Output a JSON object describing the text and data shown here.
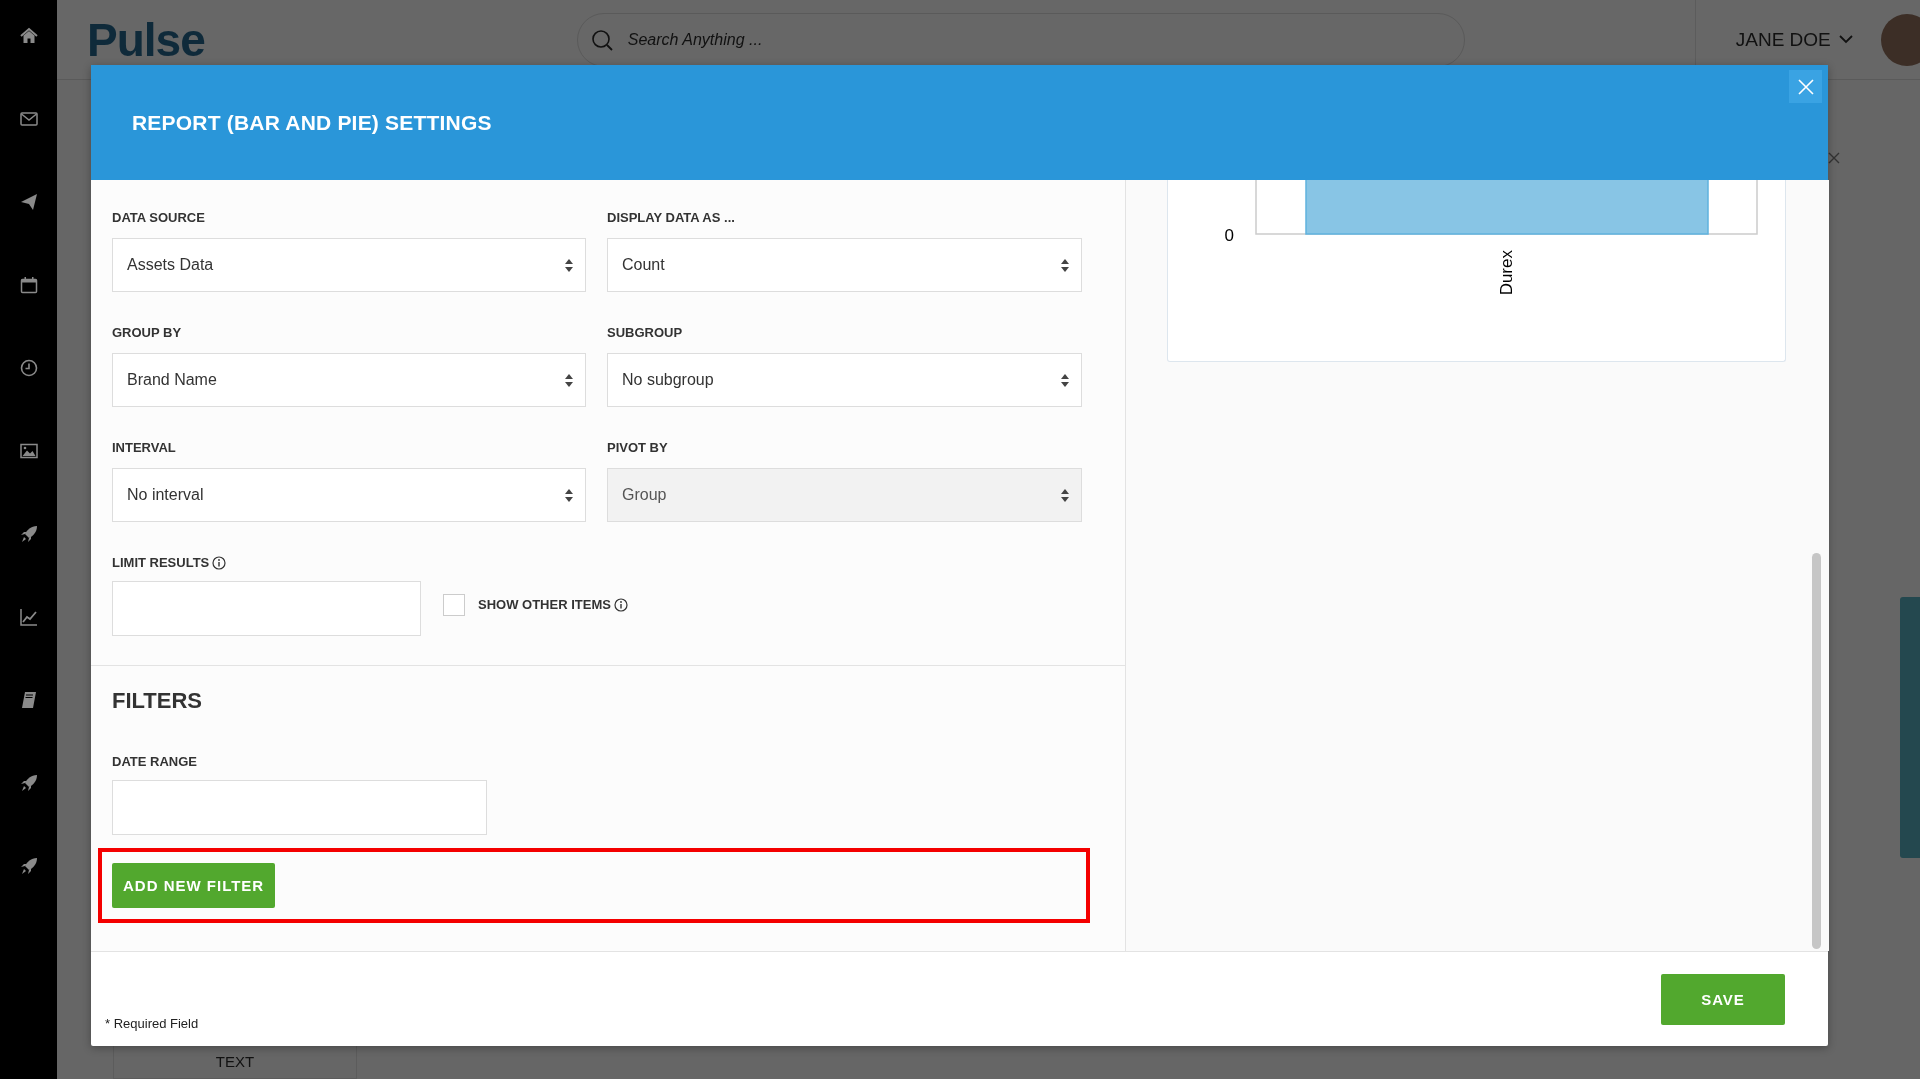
{
  "topbar": {
    "logo": "Pulse",
    "search": {
      "placeholder": "Search Anything ..."
    },
    "user": {
      "name": "JANE DOE"
    }
  },
  "background": {
    "card_text": "TEXT"
  },
  "modal": {
    "title": "REPORT (BAR AND PIE) SETTINGS",
    "settings": [
      {
        "kind": "select",
        "label": "DATA SOURCE",
        "value": "Assets Data",
        "disabled": false
      },
      {
        "kind": "select",
        "label": "DISPLAY DATA AS ...",
        "value": "Count",
        "disabled": false
      },
      {
        "kind": "select",
        "label": "GROUP BY",
        "value": "Brand Name",
        "disabled": false
      },
      {
        "kind": "select",
        "label": "SUBGROUP",
        "value": "No subgroup",
        "disabled": false
      },
      {
        "kind": "select",
        "label": "INTERVAL",
        "value": "No interval",
        "disabled": false
      },
      {
        "kind": "select",
        "label": "PIVOT BY",
        "value": "Group",
        "disabled": true
      }
    ],
    "limit": {
      "label": "LIMIT RESULTS"
    },
    "show_other_items": {
      "label": "SHOW OTHER ITEMS",
      "checked": false
    },
    "filters": {
      "heading": "FILTERS",
      "date_range": {
        "label": "DATE RANGE"
      },
      "add_button": {
        "label": "ADD NEW FILTER",
        "highlighted": true
      }
    },
    "chart": {
      "y_tick": "0",
      "category": "Durex"
    },
    "footer": {
      "note": "* Required Field",
      "save": "SAVE"
    }
  }
}
